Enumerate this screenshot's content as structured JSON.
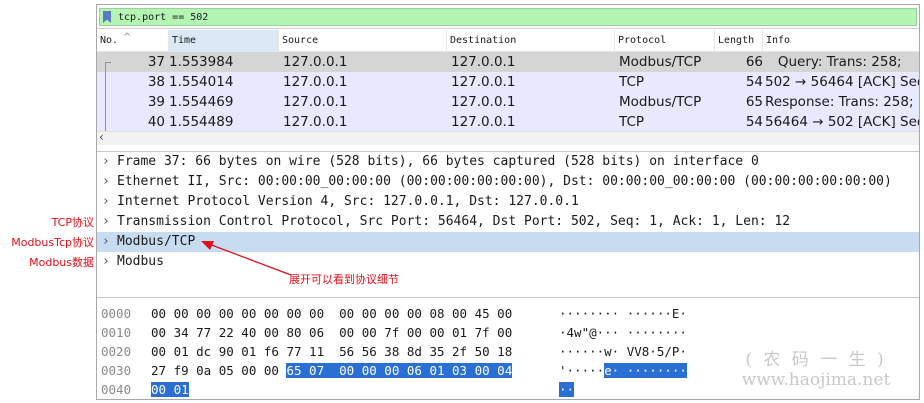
{
  "filter": {
    "value": "tcp.port == 502"
  },
  "columns": [
    {
      "label": "No."
    },
    {
      "label": "Time"
    },
    {
      "label": "Source"
    },
    {
      "label": "Destination"
    },
    {
      "label": "Protocol"
    },
    {
      "label": "Length"
    },
    {
      "label": "Info"
    }
  ],
  "packets": [
    {
      "no": "37",
      "time": "1.553984",
      "src": "127.0.0.1",
      "dst": "127.0.0.1",
      "proto": "Modbus/TCP",
      "len": "66",
      "info": "   Query: Trans: 258;"
    },
    {
      "no": "38",
      "time": "1.554014",
      "src": "127.0.0.1",
      "dst": "127.0.0.1",
      "proto": "TCP",
      "len": "54",
      "info": "502 → 56464 [ACK] Seq"
    },
    {
      "no": "39",
      "time": "1.554469",
      "src": "127.0.0.1",
      "dst": "127.0.0.1",
      "proto": "Modbus/TCP",
      "len": "65",
      "info": "Response: Trans: 258;"
    },
    {
      "no": "40",
      "time": "1.554489",
      "src": "127.0.0.1",
      "dst": "127.0.0.1",
      "proto": "TCP",
      "len": "54",
      "info": "56464 → 502 [ACK] Seq"
    }
  ],
  "details": [
    {
      "text": "Frame 37: 66 bytes on wire (528 bits), 66 bytes captured (528 bits) on interface 0"
    },
    {
      "text": "Ethernet II, Src: 00:00:00_00:00:00 (00:00:00:00:00:00), Dst: 00:00:00_00:00:00 (00:00:00:00:00:00)"
    },
    {
      "text": "Internet Protocol Version 4, Src: 127.0.0.1, Dst: 127.0.0.1"
    },
    {
      "text": "Transmission Control Protocol, Src Port: 56464, Dst Port: 502, Seq: 1, Ack: 1, Len: 12"
    },
    {
      "text": "Modbus/TCP"
    },
    {
      "text": "Modbus"
    }
  ],
  "side_labels": {
    "tcp": "TCP协议",
    "modbustcp": "ModbusTcp协议",
    "modbus": "Modbus数据"
  },
  "annotation": "展开可以看到协议细节",
  "hex_rows": [
    {
      "offset": "0000",
      "bytes": "00 00 00 00 00 00 00 00  00 00 00 00 08 00 45 00",
      "hl_bytes": "",
      "ascii": "········ ······E·",
      "hl_ascii": ""
    },
    {
      "offset": "0010",
      "bytes": "00 34 77 22 40 00 80 06  00 00 7f 00 00 01 7f 00",
      "hl_bytes": "",
      "ascii": "·4w\"@··· ········",
      "hl_ascii": ""
    },
    {
      "offset": "0020",
      "bytes": "00 01 dc 90 01 f6 77 11  56 56 38 8d 35 2f 50 18",
      "hl_bytes": "",
      "ascii": "······w· VV8·5/P·",
      "hl_ascii": ""
    },
    {
      "offset": "0030",
      "bytes": "27 f9 0a 05 00 00 ",
      "hl_bytes": "65 07  00 00 00 06 01 03 00 04",
      "ascii": "'·····",
      "hl_ascii": "e· ········"
    },
    {
      "offset": "0040",
      "bytes": "",
      "hl_bytes": "00 01",
      "ascii": "",
      "hl_ascii": "··"
    }
  ],
  "watermark": {
    "cn": "( 农 码 一 生 )",
    "url": "www.haojima.net"
  },
  "colors": {
    "filter_bg": "#b4f5b4",
    "selected_row": "#d5d5d5",
    "normal_row": "#e8e8ff",
    "detail_selected": "#c7dcf1",
    "hex_highlight": "#2a6fd6",
    "annotation": "#e0101a"
  }
}
